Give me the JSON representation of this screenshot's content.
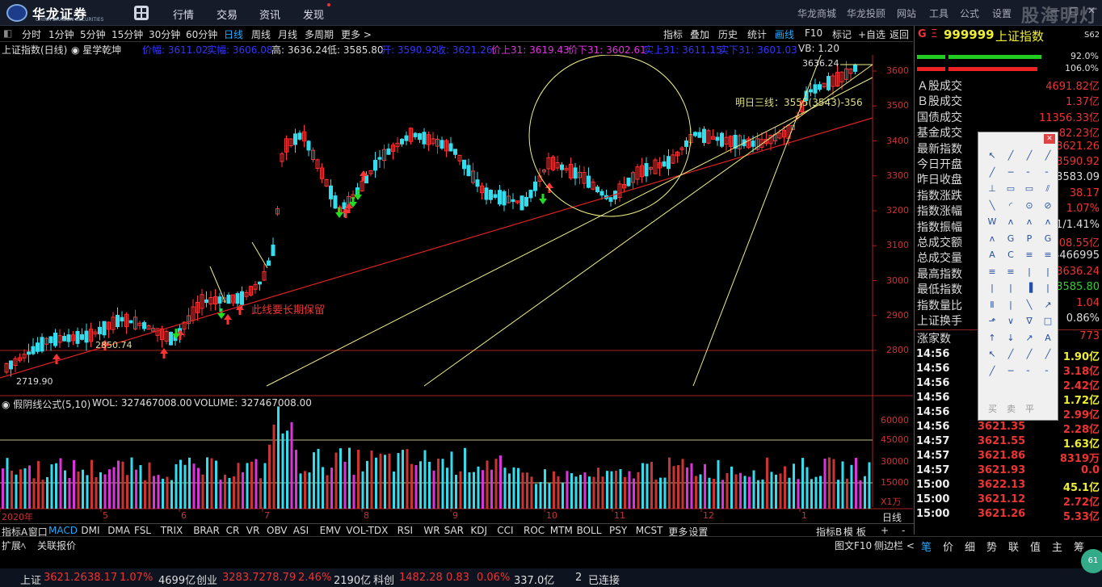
{
  "app": {
    "name": "华龙证券",
    "sub": "CHINA DRAGON SECURITIES",
    "watermark": "股海明灯"
  },
  "topmenu": [
    "行情",
    "交易",
    "资讯",
    "发现"
  ],
  "topright": [
    "华龙商城",
    "华龙投顾",
    "网站",
    "工具",
    "公式",
    "设置"
  ],
  "periods": [
    "分时",
    "1分钟",
    "5分钟",
    "15分钟",
    "30分钟",
    "60分钟",
    "日线",
    "周线",
    "月线",
    "多周期",
    "更多 >"
  ],
  "active_period": "日线",
  "toolbuttons": [
    "指标",
    "叠加",
    "历史",
    "统计",
    "画线",
    "F10",
    "标记",
    "+自选",
    "返回"
  ],
  "info": {
    "title": "上证指数(日线)",
    "strategy": "◉ 星学乾坤",
    "m1": "价幅: 3611.02",
    "m2": "实幅: 3606.08",
    "high": "高: 3636.24",
    "low": "低: 3585.80",
    "open": "开: 3590.92",
    "close": "收: 3621.26",
    "up31": "价上31: 3619.43",
    "down31": "价下31: 3602.61",
    "sup31": "实上31: 3611.15",
    "sdn31": "实下31: 3601.03",
    "vb": "VB: 1.20"
  },
  "annotations": {
    "peak": "3636.24",
    "low_label": "2719.90",
    "mid_label": "2850.74",
    "line_note": "此线要长期保留",
    "tomorrow": "明日三线：3555(3543)-356"
  },
  "price_axis": [
    "3600",
    "3500",
    "3400",
    "3300",
    "3200",
    "3100",
    "3000",
    "2900",
    "2800"
  ],
  "vol_axis": [
    "60000",
    "45000",
    "30000",
    "15000",
    "X1万"
  ],
  "vol_info": {
    "name": "◉ 假阴线公式(5,10)",
    "wol": "WOL: 327467008.00",
    "volume": "VOLUME: 327467008.00"
  },
  "months": [
    "2020年",
    "5",
    "6",
    "7",
    "8",
    "9",
    "10",
    "11",
    "12",
    "1"
  ],
  "rightpanel": {
    "code": "999999",
    "name": "上证指数",
    "g": "G",
    "eq": "Ξ",
    "right": "S62",
    "bar1": "92.0%",
    "bar2": "106.0%",
    "stats": [
      [
        "Ａ股成交",
        "4691.82亿",
        "#e33"
      ],
      [
        "Ｂ股成交",
        "1.37亿",
        "#e33"
      ],
      [
        "国债成交",
        "11356.33亿",
        "#e33"
      ],
      [
        "基金成交",
        "82.23亿",
        "#e33"
      ],
      [
        "最新指数",
        "3621.26",
        "#e33"
      ],
      [
        "今日开盘",
        "3590.92",
        "#e33"
      ],
      [
        "昨日收盘",
        "3583.09",
        "#ddd"
      ],
      [
        "指数涨跌",
        "38.17",
        "#e33"
      ],
      [
        "指数涨幅",
        "1.07%",
        "#e33"
      ],
      [
        "指数振幅",
        "1/1.41%",
        "#ddd"
      ],
      [
        "总成交额",
        "4808.55亿",
        "#e33"
      ],
      [
        "总成交量",
        "4466995",
        "#ddd"
      ],
      [
        "最高指数",
        "3636.24",
        "#e33"
      ],
      [
        "最低指数",
        "3585.80",
        "#3c3"
      ],
      [
        "指数量比",
        "1.04",
        "#e33"
      ],
      [
        "上证换手",
        "0.86%",
        "#ddd"
      ]
    ],
    "updown": [
      "涨家数",
      "773"
    ],
    "ticks": [
      [
        "14:56",
        "3621.10",
        "1.90亿"
      ],
      [
        "14:56",
        "3621.15",
        "3.18亿"
      ],
      [
        "14:56",
        "3621.20",
        "2.42亿"
      ],
      [
        "14:56",
        "3621.25",
        "1.72亿"
      ],
      [
        "14:56",
        "3621.30",
        "2.99亿"
      ],
      [
        "14:56",
        "3621.35",
        "2.28亿"
      ],
      [
        "14:57",
        "3621.55",
        "1.63亿"
      ],
      [
        "14:57",
        "3621.86",
        "8319万"
      ],
      [
        "14:57",
        "3621.93",
        "0.0"
      ],
      [
        "15:00",
        "3622.13",
        "45.1亿"
      ],
      [
        "15:00",
        "3621.12",
        "2.72亿"
      ],
      [
        "15:00",
        "3621.26",
        "5.33亿"
      ]
    ],
    "tabs": [
      "笔",
      "价",
      "细",
      "势",
      "联",
      "值",
      "主",
      "筹"
    ]
  },
  "palette": {
    "labels": [
      "买",
      "卖",
      "平"
    ],
    "text_tool": "A"
  },
  "bottomtabs": [
    "指标A",
    "窗口",
    "MACD",
    "DMI",
    "DMA",
    "FSL",
    "TRIX",
    "BRAR",
    "CR",
    "VR",
    "OBV",
    "ASI",
    "EMV",
    "VOL-TDX",
    "RSI",
    "WR",
    "SAR",
    "KDJ",
    "CCI",
    "ROC",
    "MTM",
    "BOLL",
    "PSY",
    "MCST",
    "更多",
    "设置"
  ],
  "bottomright": [
    "指标B",
    "模 板",
    "+",
    "-"
  ],
  "ext": [
    "扩展ﾍ",
    "关联报价"
  ],
  "ext_right": [
    "图文F10",
    "侧边栏 <"
  ],
  "daily_label": "日线",
  "statusbar": [
    [
      "上证",
      "#ddd"
    ],
    [
      "3621.26",
      "#e33"
    ],
    [
      "38.17",
      "#e33"
    ],
    [
      "1.07%",
      "#e33"
    ],
    [
      "4699亿",
      "#ddd"
    ],
    [
      "创业",
      "#ddd"
    ],
    [
      "3283.72",
      "#e33"
    ],
    [
      "78.79",
      "#e33"
    ],
    [
      "2.46%",
      "#e33"
    ],
    [
      "2190亿",
      "#ddd"
    ],
    [
      "科创",
      "#ddd"
    ],
    [
      "1482.28",
      "#e33"
    ],
    [
      "0.83",
      "#e33"
    ],
    [
      "0.06%",
      "#e33"
    ],
    [
      "337.0亿",
      "#ddd"
    ],
    [
      "2",
      "#ddd"
    ],
    [
      "已连接",
      "#ddd"
    ]
  ],
  "colors": {
    "up": "#ff3333",
    "down": "#33ddee",
    "ma": "#ffff66",
    "accent": "#2299ff"
  }
}
